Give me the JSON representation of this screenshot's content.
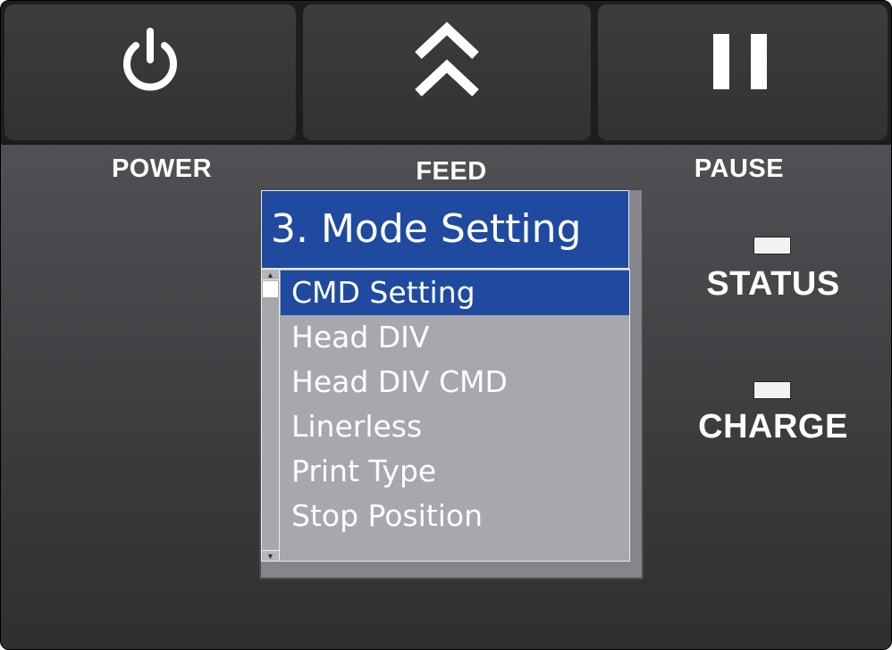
{
  "buttons": {
    "power": {
      "label": "POWER",
      "icon": "power-icon"
    },
    "feed": {
      "label": "FEED",
      "icon": "double-chevron-up-icon"
    },
    "pause": {
      "label": "PAUSE",
      "icon": "pause-icon"
    }
  },
  "lcd": {
    "title": "3. Mode Setting",
    "items": [
      {
        "label": "CMD Setting",
        "selected": true
      },
      {
        "label": "Head DIV",
        "selected": false
      },
      {
        "label": "Head DIV CMD",
        "selected": false
      },
      {
        "label": "Linerless",
        "selected": false
      },
      {
        "label": "Print Type",
        "selected": false
      },
      {
        "label": "Stop Position",
        "selected": false
      }
    ],
    "scroll_up_glyph": "▲",
    "scroll_down_glyph": "▼"
  },
  "indicators": {
    "status": {
      "label": "STATUS"
    },
    "charge": {
      "label": "CHARGE"
    }
  },
  "colors": {
    "lcd_blue": "#1f4aa0",
    "lcd_gray": "#a7a7ad",
    "panel_dark": "#3a3b3d",
    "led_white": "#f2f2f2"
  }
}
